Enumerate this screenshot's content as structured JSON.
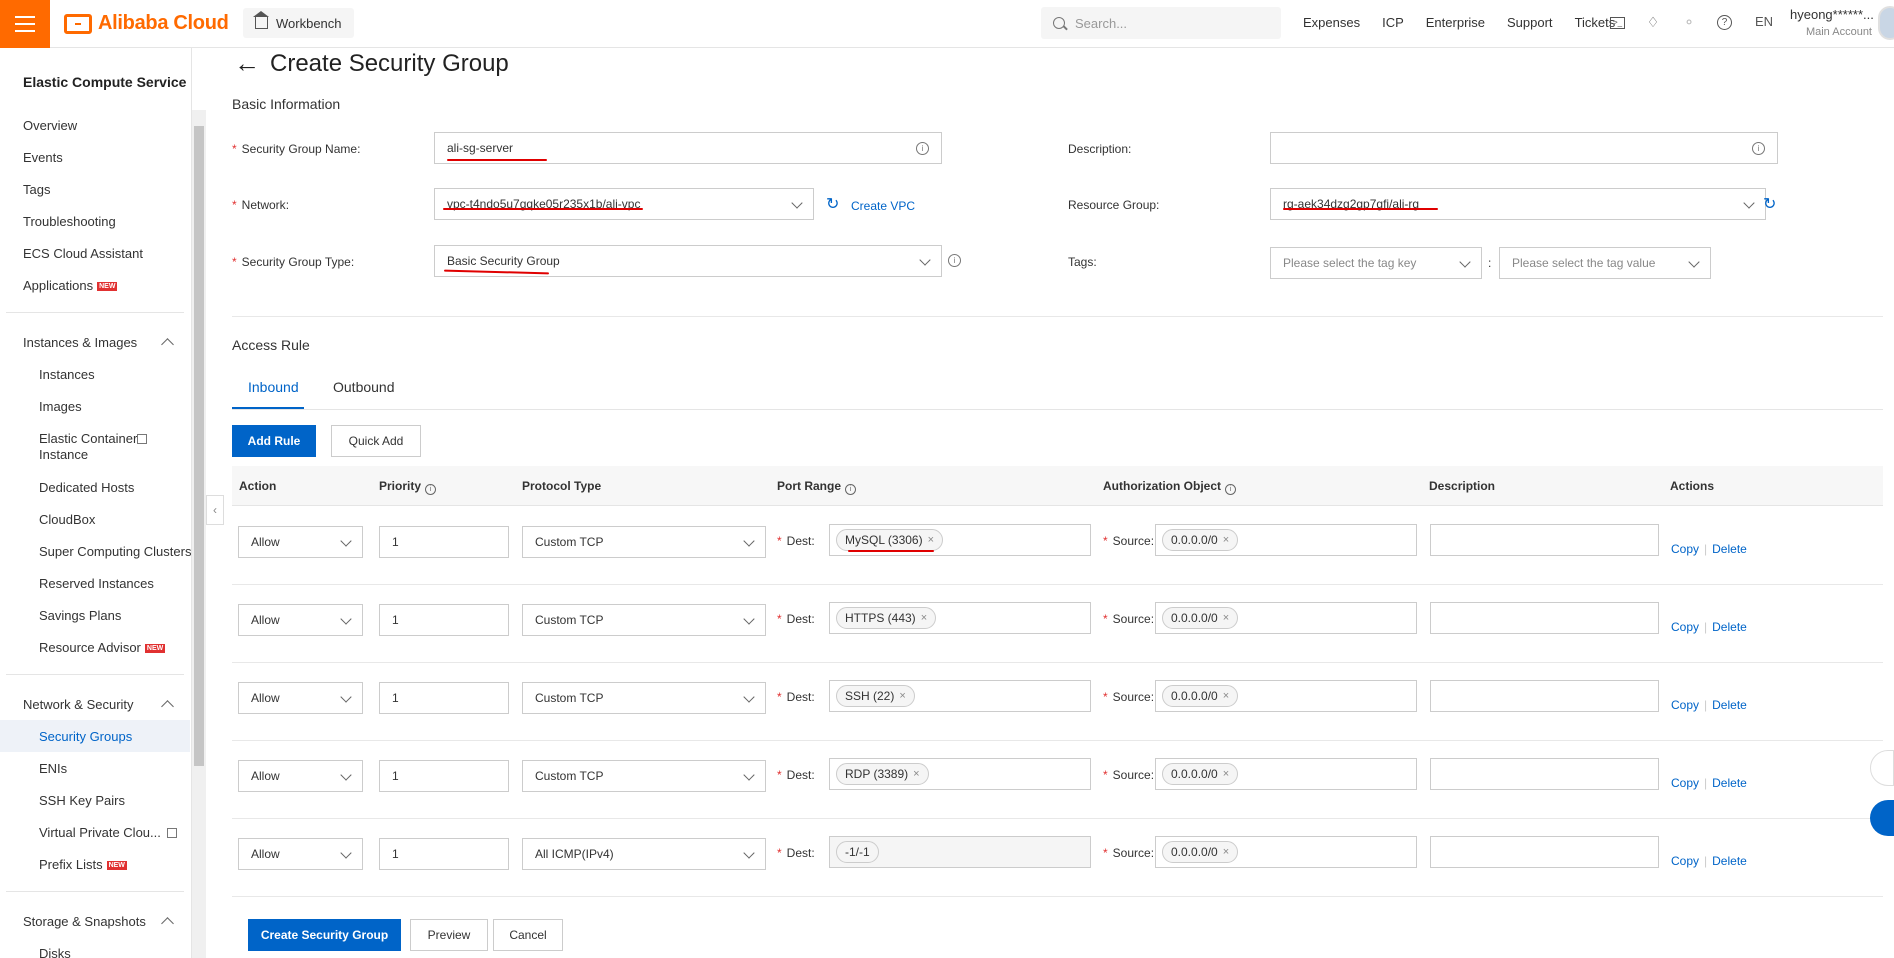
{
  "topbar": {
    "brand": "Alibaba Cloud",
    "workbench": "Workbench",
    "search_placeholder": "Search...",
    "nav": [
      "Expenses",
      "ICP",
      "Enterprise",
      "Support",
      "Tickets"
    ],
    "lang": "EN",
    "username": "hyeong******...",
    "account_type": "Main Account"
  },
  "sidebar": {
    "title": "Elastic Compute Service",
    "top_items": [
      "Overview",
      "Events",
      "Tags",
      "Troubleshooting",
      "ECS Cloud Assistant",
      "Applications"
    ],
    "sections": [
      {
        "label": "Instances & Images",
        "items": [
          "Instances",
          "Images",
          "Elastic Container Instance",
          "Dedicated Hosts",
          "CloudBox",
          "Super Computing Clusters",
          "Reserved Instances",
          "Savings Plans",
          "Resource Advisor"
        ]
      },
      {
        "label": "Network & Security",
        "items": [
          "Security Groups",
          "ENIs",
          "SSH Key Pairs",
          "Virtual Private Clou...",
          "Prefix Lists"
        ]
      },
      {
        "label": "Storage & Snapshots",
        "items": [
          "Disks"
        ]
      }
    ],
    "new_badge": "NEW",
    "active_item": "Security Groups"
  },
  "page": {
    "title": "Create Security Group",
    "basic_info": "Basic Information",
    "fields": {
      "sg_name_label": "Security Group Name",
      "sg_name_value": "ali-sg-server",
      "network_label": "Network",
      "network_value": "vpc-t4ndo5u7gqke05r235x1b/ali-vpc",
      "create_vpc": "Create VPC",
      "sg_type_label": "Security Group Type",
      "sg_type_value": "Basic Security Group",
      "description_label": "Description",
      "description_value": "",
      "resource_group_label": "Resource Group",
      "resource_group_value": "rg-aek34dzg2gp7gfi/ali-rg",
      "tags_label": "Tags",
      "tag_key_placeholder": "Please select the tag key",
      "tag_value_placeholder": "Please select the tag value",
      "tag_separator": ":"
    },
    "access_rule": "Access Rule",
    "tabs": [
      "Inbound",
      "Outbound"
    ],
    "add_rule": "Add Rule",
    "quick_add": "Quick Add",
    "columns": [
      "Action",
      "Priority",
      "Protocol Type",
      "Port Range",
      "Authorization Object",
      "Description",
      "Actions"
    ],
    "dest_label": "Dest:",
    "source_label": "Source:",
    "copy": "Copy",
    "delete": "Delete",
    "rules": [
      {
        "action": "Allow",
        "priority": "1",
        "protocol": "Custom TCP",
        "dest": "MySQL (3306)",
        "source": "0.0.0.0/0",
        "description": ""
      },
      {
        "action": "Allow",
        "priority": "1",
        "protocol": "Custom TCP",
        "dest": "HTTPS (443)",
        "source": "0.0.0.0/0",
        "description": ""
      },
      {
        "action": "Allow",
        "priority": "1",
        "protocol": "Custom TCP",
        "dest": "SSH (22)",
        "source": "0.0.0.0/0",
        "description": ""
      },
      {
        "action": "Allow",
        "priority": "1",
        "protocol": "Custom TCP",
        "dest": "RDP (3389)",
        "source": "0.0.0.0/0",
        "description": ""
      },
      {
        "action": "Allow",
        "priority": "1",
        "protocol": "All ICMP(IPv4)",
        "dest": "-1/-1",
        "source": "0.0.0.0/0",
        "description": ""
      }
    ],
    "footer": {
      "create": "Create Security Group",
      "preview": "Preview",
      "cancel": "Cancel"
    }
  },
  "colors": {
    "brand": "#ff6a00",
    "primary": "#0064c8",
    "required": "#e13131",
    "highlight": "#e00000"
  }
}
